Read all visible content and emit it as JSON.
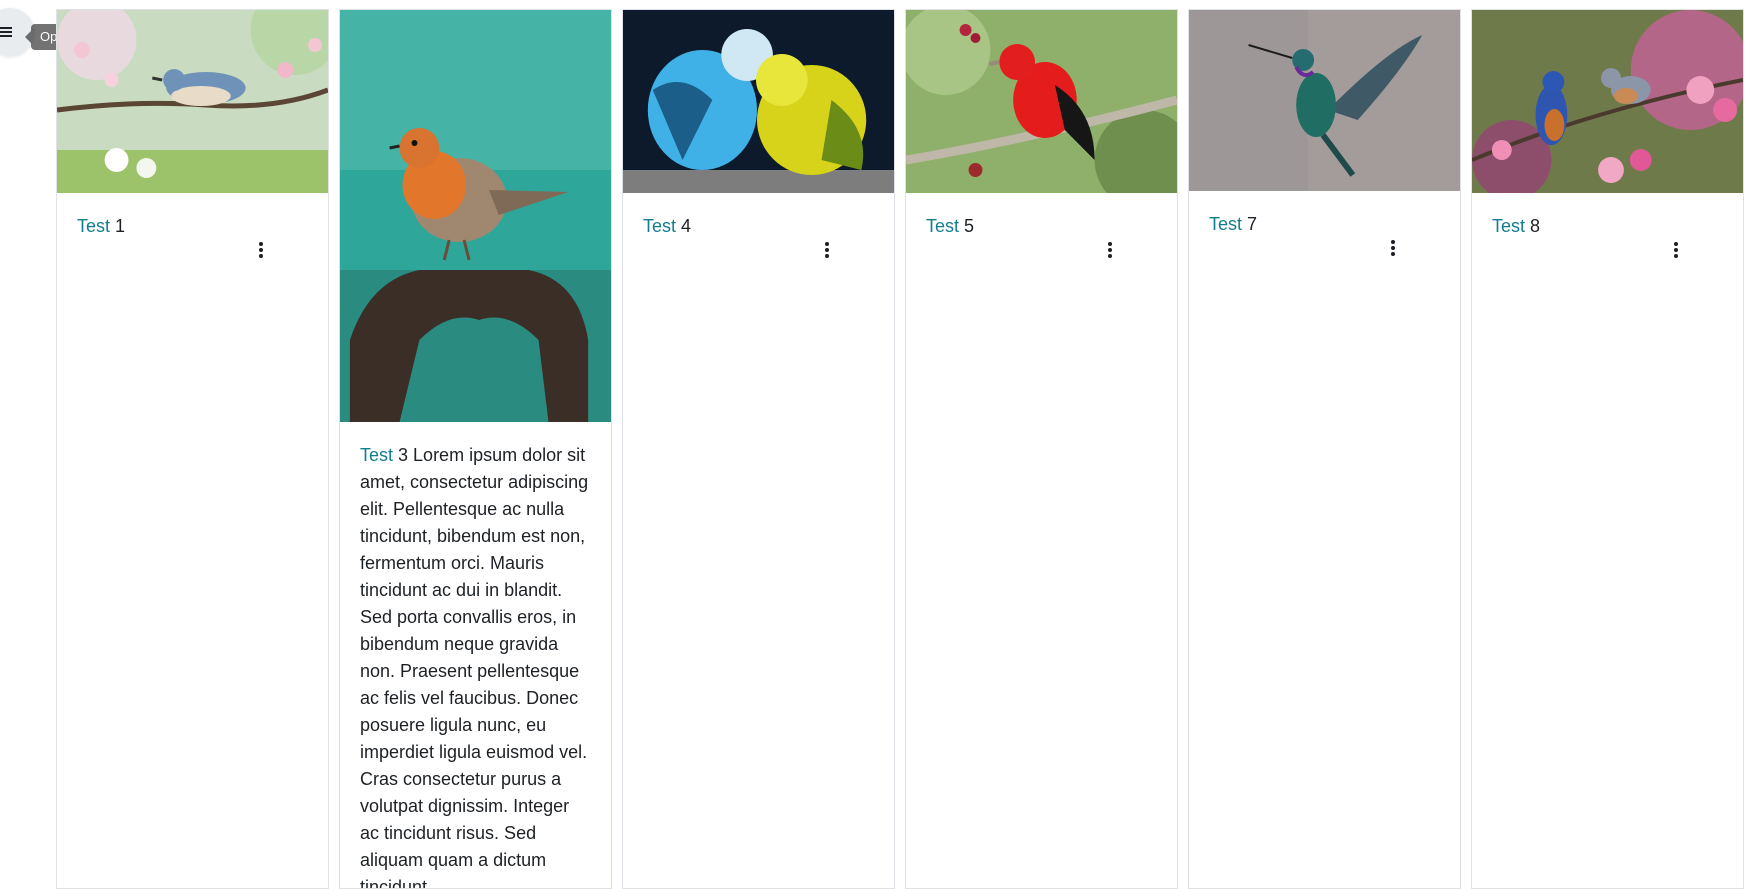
{
  "course_index": {
    "toggle_icon": "hamburger-icon",
    "tooltip": "Open course index"
  },
  "cards": [
    {
      "link_text": "Test",
      "rest_text": "1",
      "image_desc": "nuthatch-on-blossom-branch-photo",
      "menu_icon": "kebab-menu-icon"
    },
    {
      "link_text": "Test",
      "rest_text": "3 Lorem ipsum dolor sit amet, consectetur adipiscing elit. Pellentesque ac nulla tincidunt, bibendum est non, fermentum orci. Mauris tincidunt ac dui in blandit. Sed porta convallis eros, in bibendum neque gravida non. Praesent pellentesque ac felis vel faucibus. Donec posuere ligula nunc, eu imperdiet ligula euismod vel. Cras consectetur purus a volutpat dignissim. Integer ac tincidunt risus. Sed aliquam quam a dictum tincidunt.",
      "image_desc": "robin-on-rusted-metal-photo",
      "menu_icon": "kebab-menu-icon"
    },
    {
      "link_text": "Test",
      "rest_text": "4",
      "image_desc": "budgies-blue-and-yellow-photo",
      "menu_icon": "kebab-menu-icon"
    },
    {
      "link_text": "Test",
      "rest_text": "5",
      "image_desc": "red-tanager-on-branch-photo",
      "menu_icon": "kebab-menu-icon"
    },
    {
      "link_text": "Test",
      "rest_text": "7",
      "image_desc": "hummingbird-in-flight-photo",
      "menu_icon": "kebab-menu-icon"
    },
    {
      "link_text": "Test",
      "rest_text": "8",
      "image_desc": "bluebirds-on-pink-blossoms-photo",
      "menu_icon": "kebab-menu-icon"
    }
  ],
  "colors": {
    "link": "#127d8f",
    "text": "#1d2125",
    "border": "#dee2e6"
  }
}
